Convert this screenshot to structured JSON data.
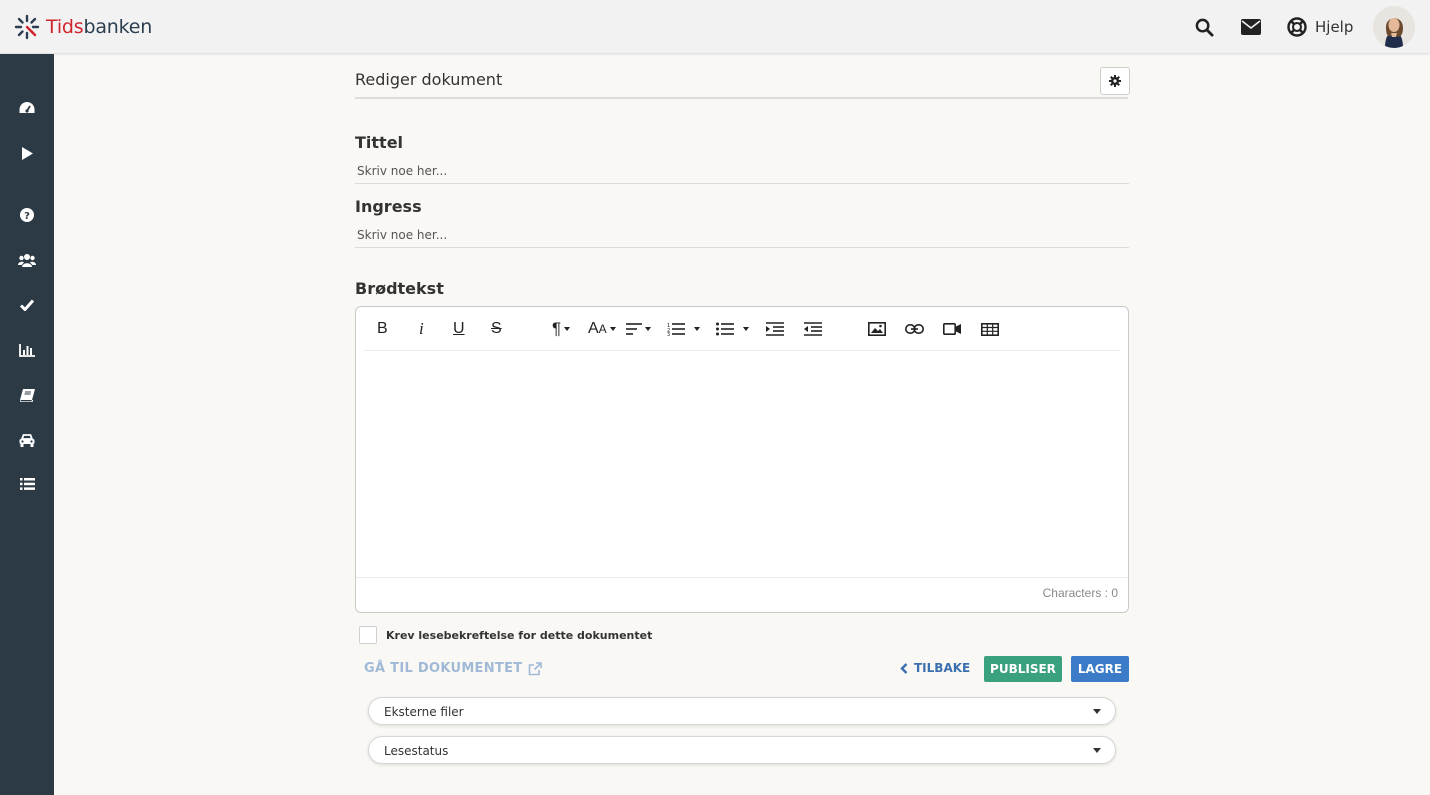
{
  "brand": {
    "name_part1": "Tids",
    "name_part2": "banken",
    "accent": "#d0242c",
    "dark": "#2c3e50"
  },
  "header": {
    "search_icon": "search-icon",
    "mail_icon": "envelope-icon",
    "help_icon": "lifebuoy-icon",
    "help_label": "Hjelp"
  },
  "sidebar": {
    "items": [
      {
        "icon": "dashboard-icon"
      },
      {
        "icon": "play-icon"
      },
      {
        "icon": "question-icon"
      },
      {
        "icon": "users-icon"
      },
      {
        "icon": "check-icon"
      },
      {
        "icon": "bar-chart-icon"
      },
      {
        "icon": "book-icon"
      },
      {
        "icon": "car-icon"
      },
      {
        "icon": "list-icon"
      }
    ]
  },
  "page": {
    "title": "Rediger dokument"
  },
  "form": {
    "title_label": "Tittel",
    "title_placeholder": "Skriv noe her...",
    "ingress_label": "Ingress",
    "ingress_placeholder": "Skriv noe her...",
    "body_label": "Brødtekst",
    "char_count": "Characters : 0",
    "read_confirm_label": "Krev lesebekreftelse for dette dokumentet",
    "read_confirm_checked": false
  },
  "toolbar": {
    "buttons": [
      "bold-icon",
      "italic-icon",
      "underline-icon",
      "strikethrough-icon",
      "paragraph-format-icon",
      "font-size-icon",
      "align-icon",
      "ordered-list-icon",
      "unordered-list-icon",
      "indent-icon",
      "outdent-icon",
      "image-icon",
      "link-icon",
      "video-icon",
      "table-icon"
    ]
  },
  "actions": {
    "goto_label": "GÅ TIL DOKUMENTET",
    "back_label": "TILBAKE",
    "publish_label": "PUBLISER",
    "save_label": "LAGRE",
    "publish_color": "#3aa17e",
    "save_color": "#3c7bc8"
  },
  "sections": [
    {
      "label": "Eksterne filer"
    },
    {
      "label": "Lesestatus"
    }
  ]
}
